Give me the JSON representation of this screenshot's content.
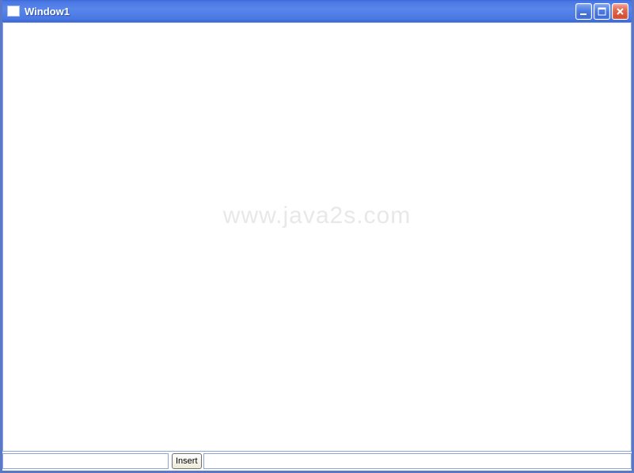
{
  "window": {
    "title": "Window1"
  },
  "watermark": {
    "text": "www.java2s.com"
  },
  "bottom": {
    "input_value": "",
    "button_label": "Insert"
  }
}
